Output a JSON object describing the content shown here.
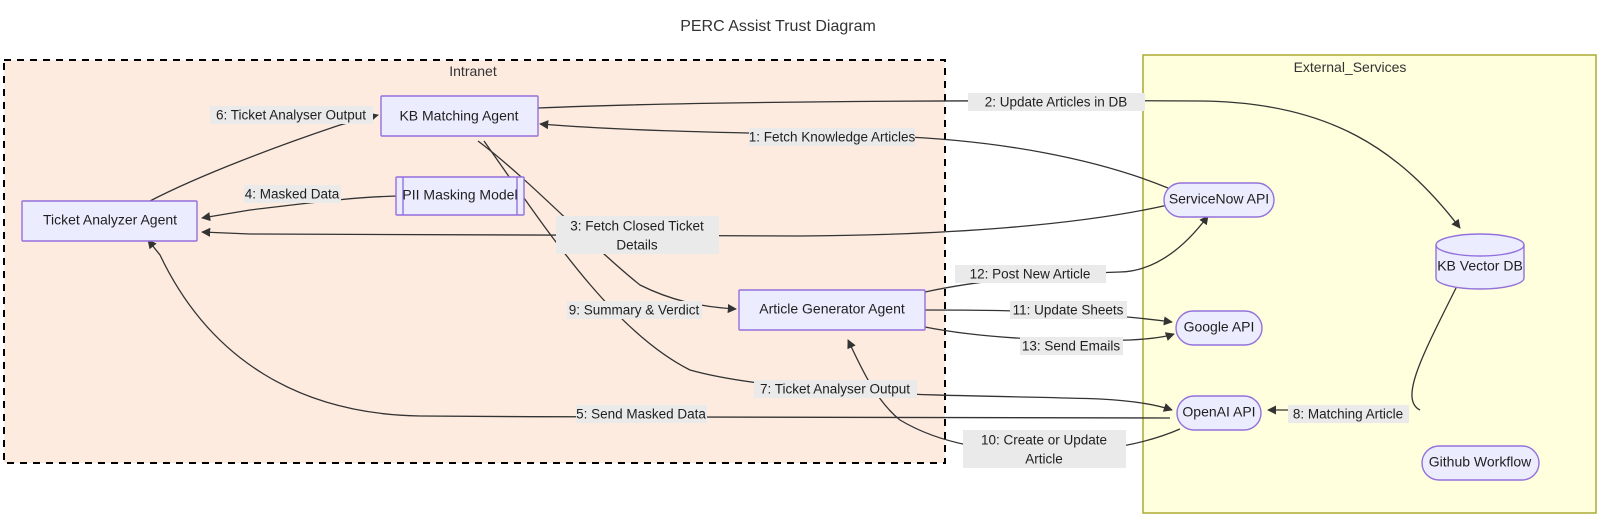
{
  "diagram": {
    "title": "PERC Assist Trust Diagram",
    "clusters": [
      {
        "id": "intranet",
        "label": "Intranet",
        "fill": "#FDEBE0",
        "stroke": "#000000",
        "style": "dashed"
      },
      {
        "id": "external",
        "label": "External_Services",
        "fill": "#FFFFDE",
        "stroke": "#AAAA33",
        "style": "solid"
      }
    ],
    "nodes": [
      {
        "id": "ticket_analyzer",
        "label": "Ticket Analyzer Agent",
        "shape": "rect",
        "cluster": "intranet"
      },
      {
        "id": "kb_matching",
        "label": "KB Matching Agent",
        "shape": "rect",
        "cluster": "intranet"
      },
      {
        "id": "pii_masking",
        "label": "PII Masking Model",
        "shape": "subroutine",
        "cluster": "intranet"
      },
      {
        "id": "article_generator",
        "label": "Article Generator Agent",
        "shape": "rect",
        "cluster": "intranet"
      },
      {
        "id": "servicenow_api",
        "label": "ServiceNow API",
        "shape": "stadium",
        "cluster": "external"
      },
      {
        "id": "kb_vector_db",
        "label": "KB Vector DB",
        "shape": "cylinder",
        "cluster": "external"
      },
      {
        "id": "google_api",
        "label": "Google API",
        "shape": "stadium",
        "cluster": "external"
      },
      {
        "id": "openai_api",
        "label": "OpenAI API",
        "shape": "stadium",
        "cluster": "external"
      },
      {
        "id": "github_workflow",
        "label": "Github Workflow",
        "shape": "stadium",
        "cluster": "external"
      }
    ],
    "edges": [
      {
        "id": "e1",
        "label": "1: Fetch Knowledge Articles",
        "from": "servicenow_api",
        "to": "kb_matching"
      },
      {
        "id": "e2",
        "label": "2: Update Articles in DB",
        "from": "kb_matching",
        "to": "kb_vector_db"
      },
      {
        "id": "e3",
        "label_line1": "3: Fetch Closed Ticket",
        "label_line2": "Details",
        "from": "servicenow_api",
        "to": "ticket_analyzer"
      },
      {
        "id": "e4",
        "label": "4: Masked Data",
        "from": "pii_masking",
        "to": "ticket_analyzer"
      },
      {
        "id": "e5",
        "label": "5: Send Masked Data",
        "from": "openai_api",
        "to": "ticket_analyzer"
      },
      {
        "id": "e6",
        "label": "6: Ticket Analyser Output",
        "from": "ticket_analyzer",
        "to": "kb_matching"
      },
      {
        "id": "e7",
        "label": "7: Ticket Analyser Output",
        "from": "kb_matching",
        "to": "openai_api"
      },
      {
        "id": "e8",
        "label": "8: Matching Article",
        "from": "kb_vector_db",
        "to": "openai_api"
      },
      {
        "id": "e9",
        "label": "9: Summary & Verdict",
        "from": "kb_matching",
        "to": "article_generator"
      },
      {
        "id": "e10",
        "label_line1": "10: Create or Update",
        "label_line2": "Article",
        "from": "openai_api",
        "to": "article_generator"
      },
      {
        "id": "e11",
        "label": "11: Update Sheets",
        "from": "article_generator",
        "to": "google_api"
      },
      {
        "id": "e12",
        "label": "12: Post New Article",
        "from": "article_generator",
        "to": "servicenow_api"
      },
      {
        "id": "e13",
        "label": "13: Send Emails",
        "from": "article_generator",
        "to": "google_api"
      }
    ]
  }
}
